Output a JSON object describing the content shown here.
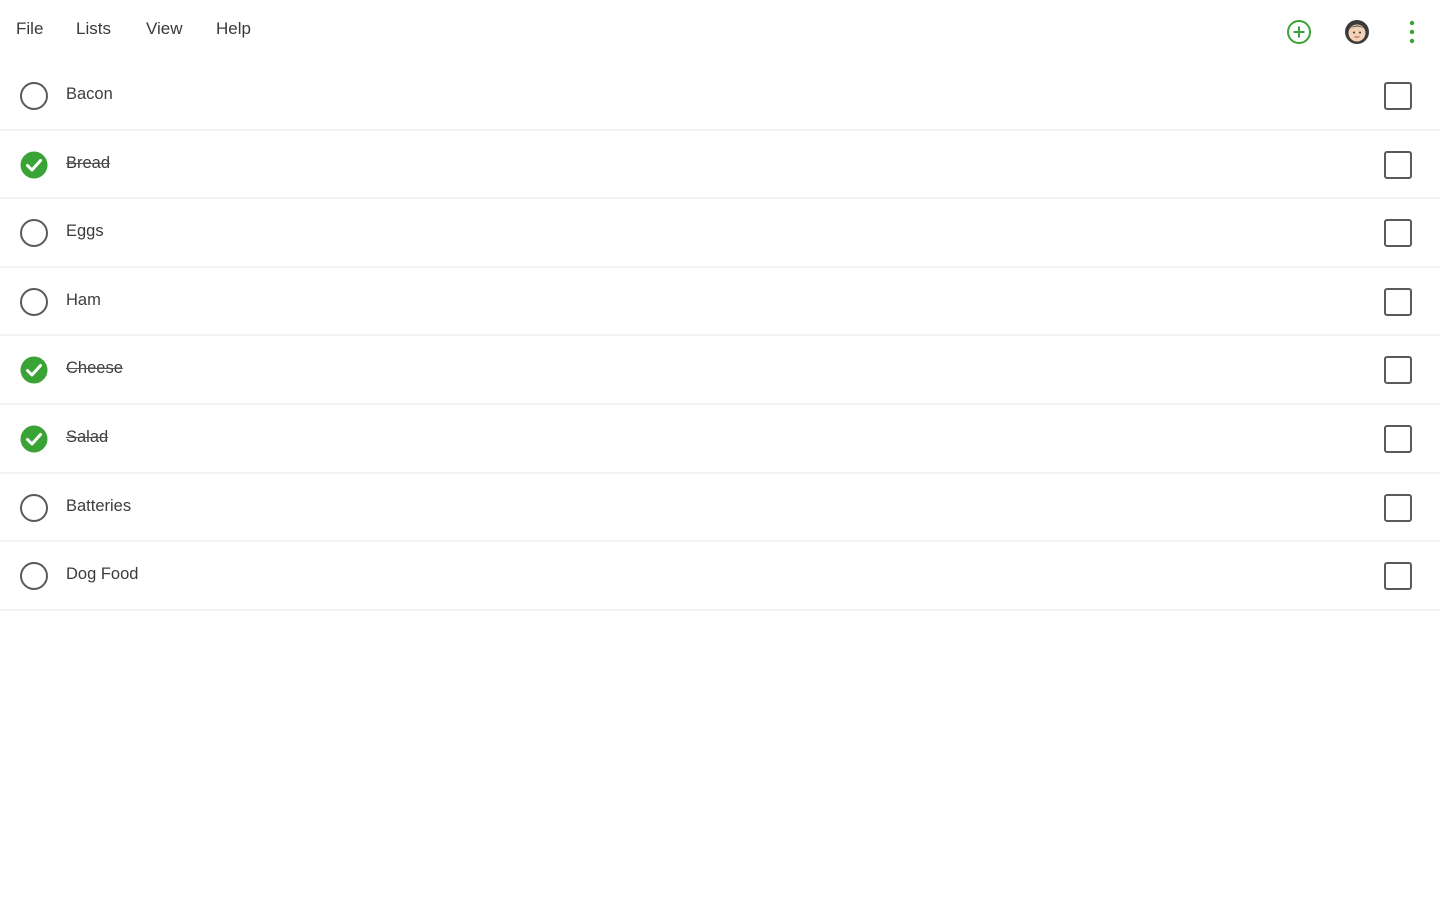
{
  "menu": {
    "file": "File",
    "lists": "Lists",
    "view": "View",
    "help": "Help"
  },
  "toolbar": {
    "add_icon": "plus-circle-icon",
    "avatar_icon": "avatar-icon",
    "more_icon": "more-vertical-icon"
  },
  "colors": {
    "accent": "#3aa335",
    "outline": "#5a5a5a"
  },
  "items": [
    {
      "label": "Bacon",
      "done": false,
      "checked": false
    },
    {
      "label": "Bread",
      "done": true,
      "checked": false
    },
    {
      "label": "Eggs",
      "done": false,
      "checked": false
    },
    {
      "label": "Ham",
      "done": false,
      "checked": false
    },
    {
      "label": "Cheese",
      "done": true,
      "checked": false
    },
    {
      "label": "Salad",
      "done": true,
      "checked": false
    },
    {
      "label": "Batteries",
      "done": false,
      "checked": false
    },
    {
      "label": "Dog Food",
      "done": false,
      "checked": false
    }
  ]
}
